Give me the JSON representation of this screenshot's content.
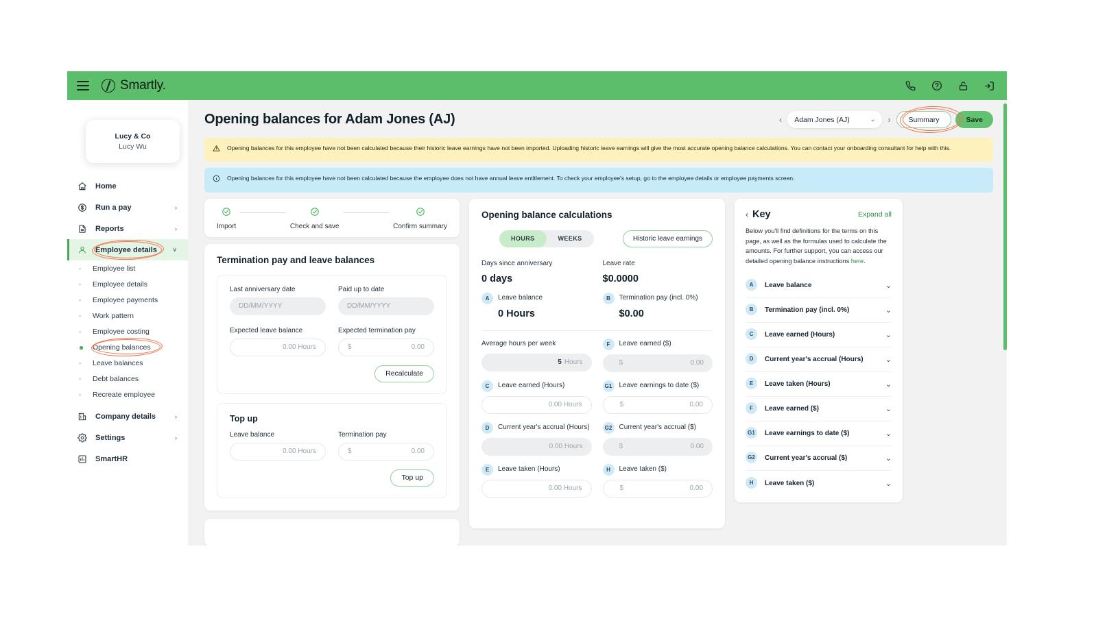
{
  "topbar": {
    "brand": "Smartly.",
    "icons": [
      "menu-icon",
      "phone-icon",
      "help-icon",
      "lock-icon",
      "logout-icon"
    ]
  },
  "sidebar": {
    "org": {
      "company": "Lucy & Co",
      "user": "Lucy Wu"
    },
    "items": [
      {
        "label": "Home",
        "icon": "home-icon",
        "chevron": ""
      },
      {
        "label": "Run a pay",
        "icon": "dollar-icon",
        "chevron": "›"
      },
      {
        "label": "Reports",
        "icon": "document-icon",
        "chevron": "›"
      },
      {
        "label": "Employee details",
        "icon": "person-icon",
        "chevron": "∨",
        "active": true
      },
      {
        "label": "Company details",
        "icon": "building-icon",
        "chevron": "›"
      },
      {
        "label": "Settings",
        "icon": "gear-icon",
        "chevron": "›"
      },
      {
        "label": "SmartHR",
        "icon": "chart-icon",
        "chevron": ""
      }
    ],
    "sub_items": [
      {
        "label": "Employee list"
      },
      {
        "label": "Employee details"
      },
      {
        "label": "Employee payments"
      },
      {
        "label": "Work pattern"
      },
      {
        "label": "Employee costing"
      },
      {
        "label": "Opening balances",
        "selected": true
      },
      {
        "label": "Leave balances"
      },
      {
        "label": "Debt balances"
      },
      {
        "label": "Recreate employee"
      }
    ]
  },
  "header": {
    "title": "Opening balances for Adam Jones (AJ)",
    "prev_arrow": "‹",
    "next_arrow": "›",
    "employee_selected": "Adam Jones (AJ)",
    "summary_label": "Summary",
    "save_label": "Save"
  },
  "banners": [
    {
      "type": "warning",
      "icon": "warning-triangle-icon",
      "text": "Opening balances for this employee have not been calculated because their historic leave earnings have not been imported. Uploading historic leave earnings will give the most accurate opening balance calculations. You can contact your onboarding consultant for help with this."
    },
    {
      "type": "info",
      "icon": "info-circle-icon",
      "text": "Opening balances for this employee have not been calculated because the employee does not have annual leave entitlement. To check your employee's setup, go to the employee details or employee payments screen."
    }
  ],
  "stepper": {
    "steps": [
      {
        "label": "Import"
      },
      {
        "label": "Check and save"
      },
      {
        "label": "Confirm summary"
      }
    ]
  },
  "termination_card": {
    "title": "Termination pay and leave balances",
    "fields": [
      {
        "label": "Last anniversary date",
        "value": "DD/MM/YYYY",
        "style": "filled"
      },
      {
        "label": "Paid up to date",
        "value": "DD/MM/YYYY",
        "style": "filled"
      },
      {
        "label": "Expected leave balance",
        "value": "0.00 Hours",
        "style": "outline"
      },
      {
        "label": "Expected termination pay",
        "prefix": "$",
        "value": "0.00",
        "style": "outline"
      }
    ],
    "button": "Recalculate"
  },
  "topup_card": {
    "title": "Top up",
    "fields": [
      {
        "label": "Leave balance",
        "value": "0.00 Hours",
        "style": "outline"
      },
      {
        "label": "Termination pay",
        "prefix": "$",
        "value": "0.00",
        "style": "outline"
      }
    ],
    "button": "Top up"
  },
  "calc_card": {
    "title": "Opening balance calculations",
    "toggle": {
      "options": [
        "HOURS",
        "WEEKS"
      ],
      "selected": "HOURS"
    },
    "historic_button": "Historic leave earnings",
    "rows": [
      {
        "label": "Days since anniversary",
        "value": "0 days",
        "kind": "big"
      },
      {
        "label": "Leave rate",
        "value": "$0.0000",
        "kind": "big"
      },
      {
        "badge": "A",
        "label": "Leave balance",
        "value": "0 Hours",
        "kind": "big"
      },
      {
        "badge": "B",
        "label": "Termination pay (incl. 0%)",
        "value": "$0.00",
        "kind": "big"
      },
      {
        "label": "Average hours per week",
        "value": "5",
        "suffix": "Hours",
        "kind": "filled"
      },
      {
        "badge": "F",
        "label": "Leave earned ($)",
        "prefix": "$",
        "value": "0.00",
        "kind": "filled"
      },
      {
        "badge": "C",
        "label": "Leave earned (Hours)",
        "value": "0.00 Hours",
        "kind": "outline"
      },
      {
        "badge": "G1",
        "label": "Leave earnings to date ($)",
        "prefix": "$",
        "value": "0.00",
        "kind": "outline"
      },
      {
        "badge": "D",
        "label": "Current year's accrual (Hours)",
        "value": "0.00 Hours",
        "kind": "filled"
      },
      {
        "badge": "G2",
        "label": "Current year's accrual ($)",
        "prefix": "$",
        "value": "0.00",
        "kind": "filled"
      },
      {
        "badge": "E",
        "label": "Leave taken (Hours)",
        "value": "0.00 Hours",
        "kind": "outline"
      },
      {
        "badge": "H",
        "label": "Leave taken ($)",
        "prefix": "$",
        "value": "0.00",
        "kind": "outline"
      }
    ]
  },
  "key_card": {
    "back_arrow": "‹",
    "title": "Key",
    "expand_all": "Expand all",
    "description_before": "Below you'll find definitions for the terms on this page, as well as the formulas used to calculate the amounts. For further support, you can access our detailed opening balance instructions ",
    "description_link": "here",
    "description_after": ".",
    "rows": [
      {
        "badge": "A",
        "label": "Leave balance"
      },
      {
        "badge": "B",
        "label": "Termination pay (incl. 0%)"
      },
      {
        "badge": "C",
        "label": "Leave earned (Hours)"
      },
      {
        "badge": "D",
        "label": "Current year's accrual (Hours)"
      },
      {
        "badge": "E",
        "label": "Leave taken (Hours)"
      },
      {
        "badge": "F",
        "label": "Leave earned ($)"
      },
      {
        "badge": "G1",
        "label": "Leave earnings to date ($)"
      },
      {
        "badge": "G2",
        "label": "Current year's accrual ($)"
      },
      {
        "badge": "H",
        "label": "Leave taken ($)"
      }
    ]
  },
  "colors": {
    "brand_green": "#5cbd6a",
    "accent_green": "#62c271",
    "warning_bg": "#fdf2bd",
    "info_bg": "#c7ebf8",
    "badge_bg": "#cfe9f7",
    "annotation": "#f0724a"
  }
}
